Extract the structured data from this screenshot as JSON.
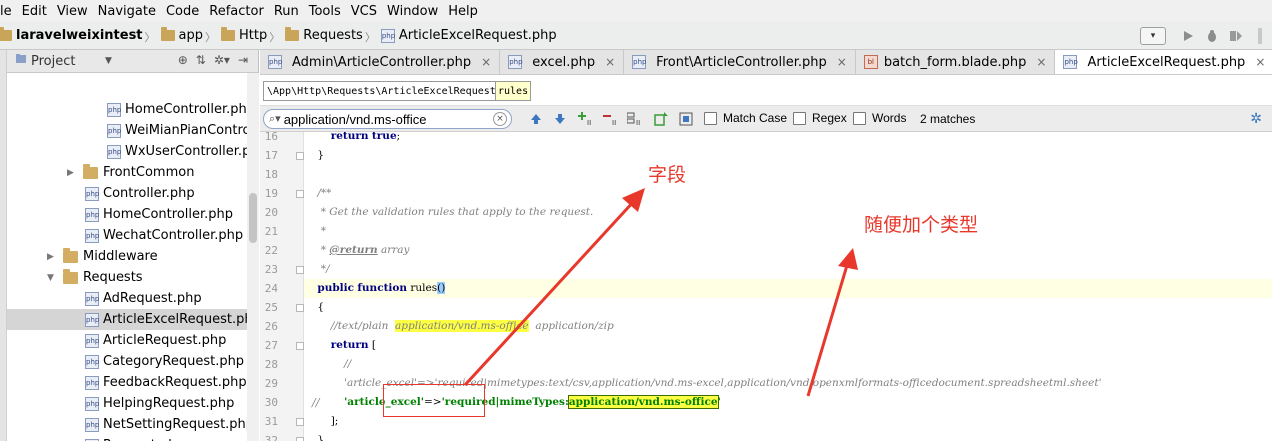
{
  "menu": [
    "le",
    "Edit",
    "View",
    "Navigate",
    "Code",
    "Refactor",
    "Run",
    "Tools",
    "VCS",
    "Window",
    "Help"
  ],
  "breadcrumb": [
    "laravelweixintest",
    "app",
    "Http",
    "Requests",
    "ArticleExcelRequest.php"
  ],
  "toolbar": {
    "run_config_label": "▾"
  },
  "project": {
    "header_label": "Project",
    "tree": [
      {
        "label": "HomeController.php",
        "type": "php",
        "indent": 2
      },
      {
        "label": "WeiMianPianControll",
        "type": "php",
        "indent": 2
      },
      {
        "label": "WxUserController.ph",
        "type": "php",
        "indent": 2
      },
      {
        "label": "FrontCommon",
        "type": "folder",
        "indent": 1,
        "arrow": "▶"
      },
      {
        "label": "Controller.php",
        "type": "php",
        "indent": 1
      },
      {
        "label": "HomeController.php",
        "type": "php",
        "indent": 1
      },
      {
        "label": "WechatController.php",
        "type": "php",
        "indent": 1
      },
      {
        "label": "Middleware",
        "type": "folder",
        "indent": 0,
        "arrow": "▶"
      },
      {
        "label": "Requests",
        "type": "folder",
        "indent": 0,
        "arrow": "▼"
      },
      {
        "label": "AdRequest.php",
        "type": "php",
        "indent": 1
      },
      {
        "label": "ArticleExcelRequest.php",
        "type": "php",
        "indent": 1,
        "selected": true
      },
      {
        "label": "ArticleRequest.php",
        "type": "php",
        "indent": 1
      },
      {
        "label": "CategoryRequest.php",
        "type": "php",
        "indent": 1
      },
      {
        "label": "FeedbackRequest.php",
        "type": "php",
        "indent": 1
      },
      {
        "label": "HelpingRequest.php",
        "type": "php",
        "indent": 1
      },
      {
        "label": "NetSettingRequest.php",
        "type": "php",
        "indent": 1
      },
      {
        "label": "Request.php",
        "type": "php",
        "indent": 1
      }
    ]
  },
  "tabs": [
    {
      "label": "Admin\\ArticleController.php",
      "icon": "php"
    },
    {
      "label": "excel.php",
      "icon": "php"
    },
    {
      "label": "Front\\ArticleController.php",
      "icon": "php"
    },
    {
      "label": "batch_form.blade.php",
      "icon": "blade"
    },
    {
      "label": "ArticleExcelRequest.php",
      "icon": "php",
      "active": true
    }
  ],
  "path": {
    "class_path": "\\App\\Http\\Requests\\ArticleExcelRequest",
    "method": "rules"
  },
  "search": {
    "query": "application/vnd.ms-office",
    "options": [
      "Match Case",
      "Regex",
      "Words"
    ],
    "match_count": "2 matches"
  },
  "editor": {
    "lines": [
      {
        "n": "16",
        "text": "        return true;"
      },
      {
        "n": "17",
        "text": "    }"
      },
      {
        "n": "18",
        "text": ""
      },
      {
        "n": "19",
        "text": "    /**"
      },
      {
        "n": "20",
        "text": "     * Get the validation rules that apply to the request."
      },
      {
        "n": "21",
        "text": "     *"
      },
      {
        "n": "22",
        "text": "     * @return array"
      },
      {
        "n": "23",
        "text": "     */"
      },
      {
        "n": "24",
        "text": "    public function rules()"
      },
      {
        "n": "25",
        "text": "    {"
      },
      {
        "n": "26",
        "text": "        //text/plain  application/vnd.ms-office  application/zip"
      },
      {
        "n": "27",
        "text": "        return ["
      },
      {
        "n": "28",
        "text": "            //"
      },
      {
        "n": "29",
        "text": "            'article_excel'=>'required|mimetypes:text/csv,application/vnd.ms-excel,application/vnd.openxmlformats-officedocument.spreadsheetml.sheet'"
      },
      {
        "n": "30",
        "text": "            'article_excel'=>'required|mimeTypes:application/vnd.ms-office'"
      },
      {
        "n": "31",
        "text": "        ];"
      },
      {
        "n": "32",
        "text": "    }"
      }
    ],
    "line29_gutter_comment": "//"
  },
  "annotations": {
    "field_label": "字段",
    "type_label": "随便加个类型"
  },
  "colors": {
    "annotation": "#e8382c",
    "highlight": "#fcff42"
  }
}
